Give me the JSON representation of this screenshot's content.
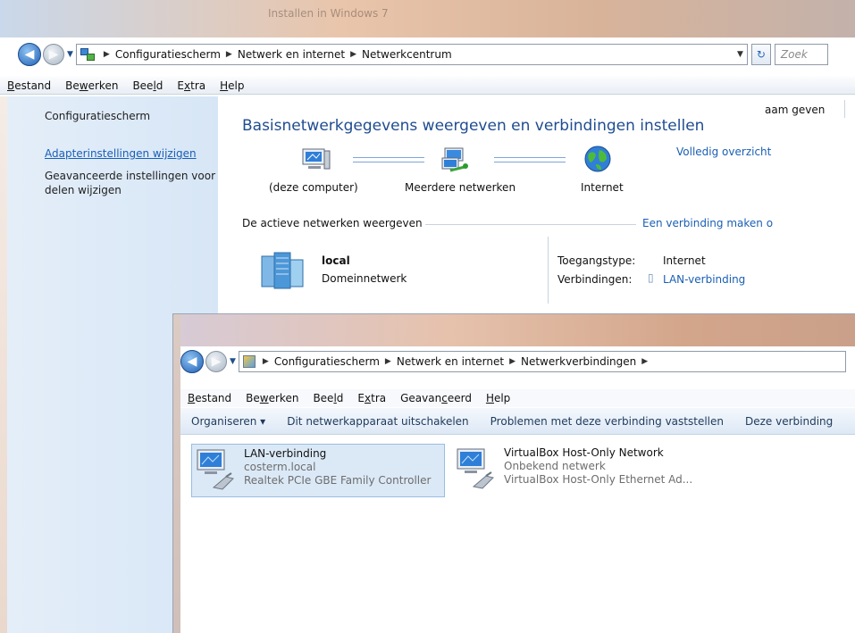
{
  "w1": {
    "title": "Installen in Windows 7",
    "breadcrumb": [
      "Configuratiescherm",
      "Netwerk en internet",
      "Netwerkcentrum"
    ],
    "search_placeholder": "Zoek",
    "menu": [
      {
        "label": "Bestand",
        "u": "B",
        "rest": "estand"
      },
      {
        "label": "Bewerken",
        "pre": "Be",
        "u": "w",
        "rest": "erken"
      },
      {
        "label": "Beeld",
        "pre": "Bee",
        "u": "l",
        "rest": "d"
      },
      {
        "label": "Extra",
        "pre": "E",
        "u": "x",
        "rest": "tra"
      },
      {
        "label": "Help",
        "u": "H",
        "rest": "elp"
      }
    ],
    "top_right_link": "aam geven",
    "sidebar": {
      "home": "Configuratiescherm",
      "adapter_link": "Adapterinstellingen wijzigen",
      "advanced_line1": "Geavanceerde instellingen voor",
      "advanced_line2": "delen wijzigen"
    },
    "heading": "Basisnetwerkgegevens weergeven en verbindingen instellen",
    "full_overview": "Volledig overzicht",
    "nodes": [
      "(deze computer)",
      "Meerdere netwerken",
      "Internet"
    ],
    "active_networks_label": "De actieve netwerken weergeven",
    "make_connection_link": "Een verbinding maken o",
    "network": {
      "name": "local",
      "type": "Domeinnetwerk",
      "access_type_label": "Toegangstype:",
      "access_type_value": "Internet",
      "connections_label": "Verbindingen:",
      "connections_value": "LAN-verbinding"
    }
  },
  "w2": {
    "breadcrumb": [
      "Configuratiescherm",
      "Netwerk en internet",
      "Netwerkverbindingen"
    ],
    "menu": [
      {
        "u": "B",
        "rest": "estand"
      },
      {
        "pre": "Be",
        "u": "w",
        "rest": "erken"
      },
      {
        "pre": "Bee",
        "u": "l",
        "rest": "d"
      },
      {
        "pre": "E",
        "u": "x",
        "rest": "tra"
      },
      {
        "pre": "Geavan",
        "u": "c",
        "rest": "eerd"
      },
      {
        "u": "H",
        "rest": "elp"
      }
    ],
    "commands": [
      "Organiseren ▾",
      "Dit netwerkapparaat uitschakelen",
      "Problemen met deze verbinding vaststellen",
      "Deze verbinding"
    ],
    "adapters": [
      {
        "name": "LAN-verbinding",
        "network": "costerm.local",
        "device": "Realtek PCIe GBE Family Controller"
      },
      {
        "name": "VirtualBox Host-Only Network",
        "network": "Onbekend netwerk",
        "device": "VirtualBox Host-Only Ethernet Ad..."
      }
    ]
  }
}
